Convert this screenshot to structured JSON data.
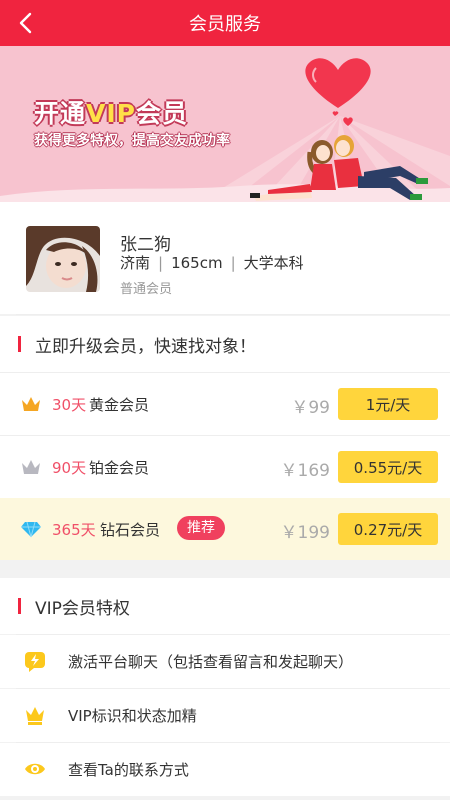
{
  "header": {
    "title": "会员服务"
  },
  "banner": {
    "title_prefix": "开通",
    "title_vip": "VIP",
    "title_suffix": "会员",
    "subtitle": "获得更多特权，提高交友成功率"
  },
  "profile": {
    "name": "张二狗",
    "city": "济南",
    "height": "165cm",
    "education": "大学本科",
    "level": "普通会员"
  },
  "upgrade": {
    "heading": "立即升级会员，快速找对象！",
    "plans": [
      {
        "days": "30天",
        "name": "黄金会员",
        "price": "￥99",
        "rate": "1元/天",
        "icon": "gold-crown-icon",
        "icon_color": "#f5a623"
      },
      {
        "days": "90天",
        "name": "铂金会员",
        "price": "￥169",
        "rate": "0.55元/天",
        "icon": "platinum-crown-icon",
        "icon_color": "#b8b8c0"
      },
      {
        "days": "365天",
        "name": "钻石会员",
        "badge": "推荐",
        "price": "￥199",
        "rate": "0.27元/天",
        "icon": "diamond-icon",
        "icon_color": "#2fb8f0"
      }
    ]
  },
  "privileges": {
    "heading": "VIP会员特权",
    "items": [
      {
        "text": "激活平台聊天（包括查看留言和发起聊天）",
        "icon": "chat-lightning-icon"
      },
      {
        "text": "VIP标识和状态加精",
        "icon": "crown-icon"
      },
      {
        "text": "查看Ta的联系方式",
        "icon": "eye-icon"
      }
    ]
  },
  "colors": {
    "brand_red": "#f0243f",
    "rate_button_yellow": "#ffd53c",
    "banner_pink": "#f7c3cf",
    "highlight_row": "#fdf8dd",
    "icon_yellow": "#fcc81c"
  }
}
